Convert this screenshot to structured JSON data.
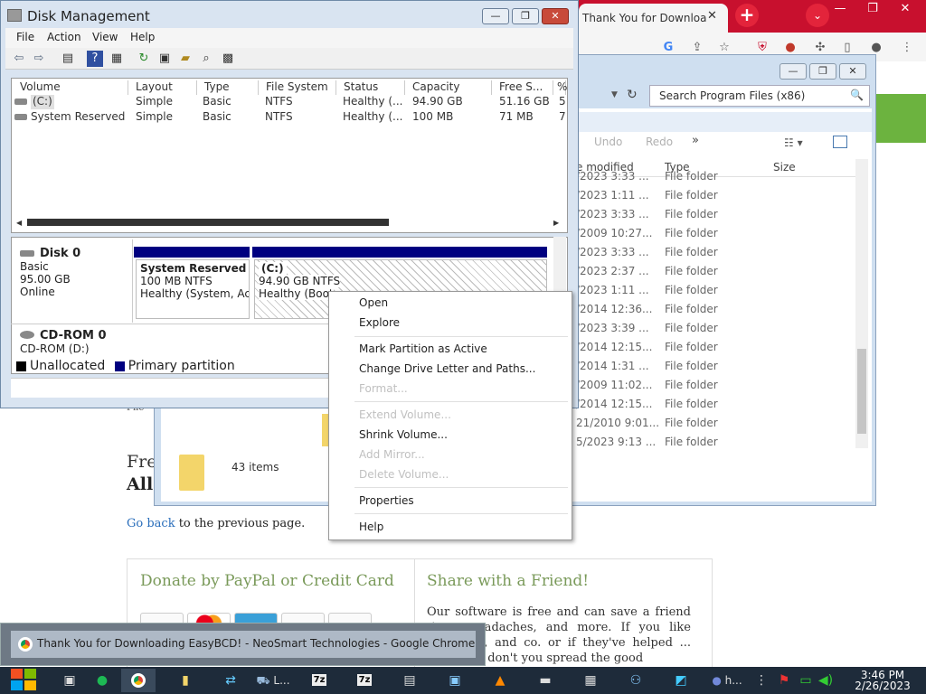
{
  "chrome": {
    "tab_title": "Thank You for Downloa",
    "tab_close": "✕",
    "new_tab": "+",
    "tab_list": "⌄",
    "win_min": "—",
    "win_max": "❐",
    "win_close": "✕"
  },
  "webpage": {
    "heading_1": "Fre",
    "heading_2": "All",
    "go_back_link": "Go back",
    "go_back_rest": " to the previous page.",
    "donate_title": "Donate by PayPal or Credit Card",
    "share_title": "Share with a Friend!",
    "share_text": "Our software is free and can save a friend time, ...eadaches, and more. If you like ...iReboot, and co. or if they've helped ... past, why don't you spread the good",
    "fragment_file": "File"
  },
  "explorer": {
    "search_placeholder": "Search Program Files (x86)",
    "undo": "Undo",
    "redo": "Redo",
    "more": "»",
    "columns": {
      "modified": "e modified",
      "type": "Type",
      "size": "Size"
    },
    "rows": [
      {
        "date": "/2023 3:33 ...",
        "type": "File folder"
      },
      {
        "date": "/2023 1:11 ...",
        "type": "File folder"
      },
      {
        "date": "/2023 3:33 ...",
        "type": "File folder"
      },
      {
        "date": "/2009 10:27...",
        "type": "File folder"
      },
      {
        "date": "/2023 3:33 ...",
        "type": "File folder"
      },
      {
        "date": "/2023 2:37 ...",
        "type": "File folder"
      },
      {
        "date": "/2023 1:11 ...",
        "type": "File folder"
      },
      {
        "date": "/2014 12:36...",
        "type": "File folder"
      },
      {
        "date": "/2023 3:39 ...",
        "type": "File folder"
      },
      {
        "date": "/2014 12:15...",
        "type": "File folder"
      },
      {
        "date": "/2014 1:31 ...",
        "type": "File folder"
      },
      {
        "date": "/2009 11:02...",
        "type": "File folder"
      },
      {
        "date": "/2014 12:15...",
        "type": "File folder"
      },
      {
        "date": "21/2010 9:01...",
        "type": "File folder"
      },
      {
        "date": "5/2023 9:13 ...",
        "type": "File folder"
      }
    ],
    "items_count": "43 items"
  },
  "disk_management": {
    "title": "Disk Management",
    "menu": [
      "File",
      "Action",
      "View",
      "Help"
    ],
    "columns": [
      "Volume",
      "Layout",
      "Type",
      "File System",
      "Status",
      "Capacity",
      "Free S...",
      "%"
    ],
    "volumes": [
      {
        "volume": "(C:)",
        "layout": "Simple",
        "type": "Basic",
        "fs": "NTFS",
        "status": "Healthy (...",
        "capacity": "94.90 GB",
        "free": "51.16 GB",
        "pct": "5"
      },
      {
        "volume": "System Reserved",
        "layout": "Simple",
        "type": "Basic",
        "fs": "NTFS",
        "status": "Healthy (...",
        "capacity": "100 MB",
        "free": "71 MB",
        "pct": "7"
      }
    ],
    "disk0": {
      "name": "Disk 0",
      "kind": "Basic",
      "size": "95.00 GB",
      "state": "Online"
    },
    "partitions": [
      {
        "title": "System Reserved",
        "size": "100 MB NTFS",
        "health": "Healthy (System, Act"
      },
      {
        "title": "(C:)",
        "size": "94.90 GB NTFS",
        "health": "Healthy (Boot"
      }
    ],
    "cdrom": {
      "name": "CD-ROM 0",
      "drive": "CD-ROM (D:)"
    },
    "legend": {
      "unallocated": "Unallocated",
      "primary": "Primary partition"
    }
  },
  "context_menu": {
    "items": [
      {
        "label": "Open",
        "enabled": true
      },
      {
        "label": "Explore",
        "enabled": true
      },
      {
        "label": "Mark Partition as Active",
        "enabled": true
      },
      {
        "label": "Change Drive Letter and Paths...",
        "enabled": true
      },
      {
        "label": "Format...",
        "enabled": false
      },
      {
        "label": "Extend Volume...",
        "enabled": false
      },
      {
        "label": "Shrink Volume...",
        "enabled": true
      },
      {
        "label": "Add Mirror...",
        "enabled": false
      },
      {
        "label": "Delete Volume...",
        "enabled": false
      },
      {
        "label": "Properties",
        "enabled": true
      },
      {
        "label": "Help",
        "enabled": true
      }
    ]
  },
  "taskbar": {
    "popup_title": "Thank You for Downloading EasyBCD! - NeoSmart Technologies - Google Chrome",
    "task_l": "L...",
    "task_7z": "7z",
    "task_h": "h...",
    "time": "3:46 PM",
    "date": "2/26/2023"
  }
}
